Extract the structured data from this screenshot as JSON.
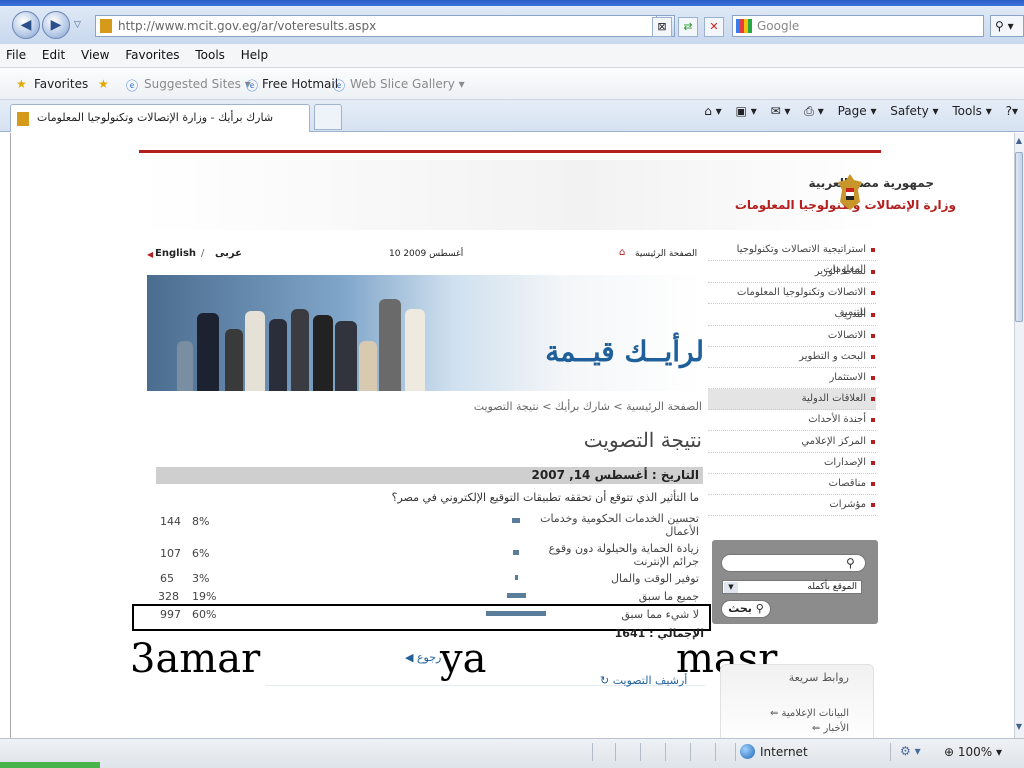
{
  "browser": {
    "url": "http://www.mcit.gov.eg/ar/voteresults.aspx",
    "search_placeholder": "Google",
    "menu": [
      "File",
      "Edit",
      "View",
      "Favorites",
      "Tools",
      "Help"
    ],
    "favorites_label": "Favorites",
    "fav_links": [
      "Suggested Sites ▾",
      "Free Hotmail",
      "Web Slice Gallery ▾"
    ],
    "tab_title": "شارك برأيك - وزارة الإتصالات وتكنولوجيا المعلومات",
    "commands": [
      "Page ▾",
      "Safety ▾",
      "Tools ▾"
    ],
    "status_zone": "Internet",
    "zoom": "100%"
  },
  "site": {
    "country": "جمهورية مصر العربية",
    "ministry": "وزارة الإتصالات وتكنولوجيا المعلومات",
    "home_link": "الصفحة الرئيسية",
    "date": "10 أغسطس 2009",
    "lang_arabic": "عربى",
    "lang_sep": "/",
    "lang_english": "English",
    "slogan": "لرأيــك قيــمة",
    "breadcrumb": "الصفحة الرئيسية > شارك برأيك > نتيجة التصويت",
    "page_title": "نتيجة التصويت",
    "vote_date": "التاريخ : أغسطس 14, 2007",
    "question": "ما التأثير الذي تتوقع أن تحققه تطبيقات التوقيع الإلكتروني في مصر؟",
    "answers": [
      {
        "label": "تحسين الخدمات الحكومية وخدمات الأعمال",
        "percent": "8%",
        "count": "144",
        "share": 8
      },
      {
        "label": "زيادة الحماية والحيلولة دون وقوع جرائم الإنترنت",
        "percent": "6%",
        "count": "107",
        "share": 6
      },
      {
        "label": "توفير الوقت والمال",
        "percent": "3%",
        "count": "65",
        "share": 3
      },
      {
        "label": "جميع ما سبق",
        "percent": "19%",
        "count": "328",
        "share": 19
      },
      {
        "label": "لا شيء مما سبق",
        "percent": "60%",
        "count": "997",
        "share": 60
      }
    ],
    "total": "الإجمالي : 1641",
    "back_link": "رجوع",
    "archive_link": "أرشيف التصويت",
    "sidebar": [
      "استراتيجية الاتصالات وتكنولوجيا المعلومات",
      "نشاط الوزير",
      "الاتصالات وتكنولوجيا المعلومات للتنمية",
      "التدريب",
      "الاتصالات",
      "البحث و التطوير",
      "الاستثمار",
      "العلاقات الدولية",
      "أجندة الأحداث",
      "المركز الإعلامي",
      "الإصدارات",
      "مناقصات",
      "مؤشرات"
    ],
    "search_scope": "الموقع بأكمله",
    "search_button": "بحث",
    "quick_links_title": "روابط سريعة",
    "quick_links": [
      "البيانات الإعلامية",
      "الأخبار"
    ]
  },
  "overlay_caption": {
    "left": "3amar",
    "middle": "ya",
    "right": "masr"
  }
}
